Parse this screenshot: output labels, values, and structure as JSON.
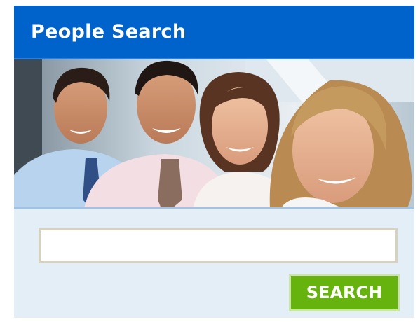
{
  "header": {
    "title": "People Search"
  },
  "photo": {
    "description_icon": "group-of-people-photo"
  },
  "search": {
    "input_value": "",
    "input_placeholder": "",
    "button_label": "SEARCH"
  },
  "colors": {
    "header_bg": "#0063cc",
    "panel_bg": "#e3eef7",
    "button_bg": "#66b30e",
    "input_border": "#d6d2bd"
  }
}
